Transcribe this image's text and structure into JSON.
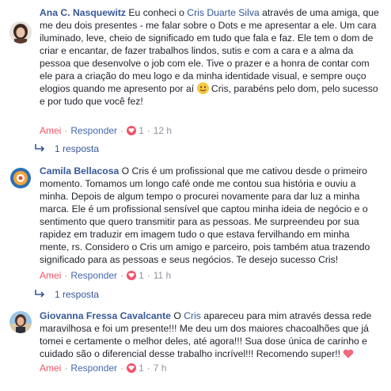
{
  "comments": [
    {
      "author": "Ana C. Nasquewitz",
      "text_before": " Eu conheci o ",
      "mention": "Cris Duarte Silva",
      "text_after": " através de uma amiga, que me deu dois presentes - me falar sobre o Dots e me apresentar a ele. Um cara iluminado, leve, cheio de significado em tudo que fala e faz. Ele tem o dom de criar e encantar, de fazer trabalhos lindos, sutis e com a cara e a alma da pessoa que desenvolve o job com ele. Tive o prazer e a honra de contar com ele para a criação do meu logo e da minha identidade visual, e sempre ouço elogios quando me apresento por aí ",
      "text_end": " Cris, parabéns pelo dom, pelo sucesso e por tudo que você fez!",
      "like_label": "Amei",
      "reply_label": "Responder",
      "reaction_count": "1",
      "time": "12 h",
      "replies": "1 resposta"
    },
    {
      "author": "Camila Bellacosa",
      "text": " O Cris é um profissional que me cativou desde o primeiro momento. Tomamos um longo café onde me contou sua história e ouviu a minha. Depois de algum tempo o procurei novamente para dar luz a minha marca. Ele é um profissional sensível que captou minha ideia de negócio e o sentimento que quero transmitir para as pessoas. Me surpreendeu por sua rapidez em traduzir em imagem tudo o que estava fervilhando em minha mente, rs. Considero o Cris um amigo e parceiro, pois também atua trazendo significado para as pessoas e seus negócios. Te desejo sucesso Cris!",
      "like_label": "Amei",
      "reply_label": "Responder",
      "reaction_count": "1",
      "time": "11 h",
      "replies": "1 resposta"
    },
    {
      "author": "Giovanna Fressa Cavalcante",
      "text_before": " O ",
      "mention": "Cris",
      "text_after": " apareceu para mim através dessa rede maravilhosa e foi um presente!!! Me deu um dos maiores chacoalhões que já tomei e certamente o melhor deles, até agora!!! Sua dose única de carinho e cuidado são o diferencial desse trabalho incrível!!! Recomendo super!! ",
      "like_label": "Amei",
      "reply_label": "Responder",
      "reaction_count": "1",
      "time": "7 h"
    }
  ],
  "colors": {
    "link": "#365899",
    "love": "#f25268",
    "meta": "#90949c"
  }
}
